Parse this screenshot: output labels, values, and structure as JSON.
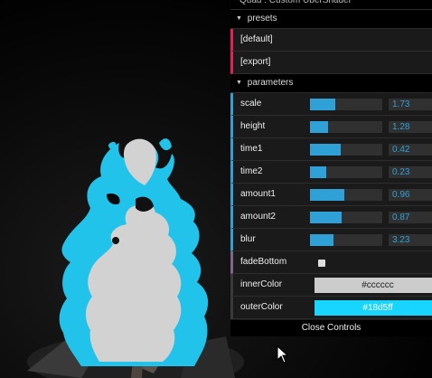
{
  "gui": {
    "title": "Quad : Custom UberShader",
    "presets": {
      "label": "presets",
      "items": [
        "[default]",
        "[export]"
      ]
    },
    "parameters": {
      "label": "parameters",
      "scale": {
        "label": "scale",
        "value": "1.73",
        "fraction": 0.35
      },
      "height": {
        "label": "height",
        "value": "1.28",
        "fraction": 0.25
      },
      "time1": {
        "label": "time1",
        "value": "0.42",
        "fraction": 0.42
      },
      "time2": {
        "label": "time2",
        "value": "0.23",
        "fraction": 0.23
      },
      "amount1": {
        "label": "amount1",
        "value": "0.96",
        "fraction": 0.48
      },
      "amount2": {
        "label": "amount2",
        "value": "0.87",
        "fraction": 0.44
      },
      "blur": {
        "label": "blur",
        "value": "3.23",
        "fraction": 0.32
      },
      "fadeBottom": {
        "label": "fadeBottom",
        "checked": false
      },
      "innerColor": {
        "label": "innerColor",
        "value": "#cccccc"
      },
      "outerColor": {
        "label": "outerColor",
        "value": "#18d5ff"
      }
    },
    "close_label": "Close Controls"
  },
  "colors": {
    "accent": "#2fa1d6",
    "function": "#e61d5f",
    "boolean": "#806787"
  }
}
